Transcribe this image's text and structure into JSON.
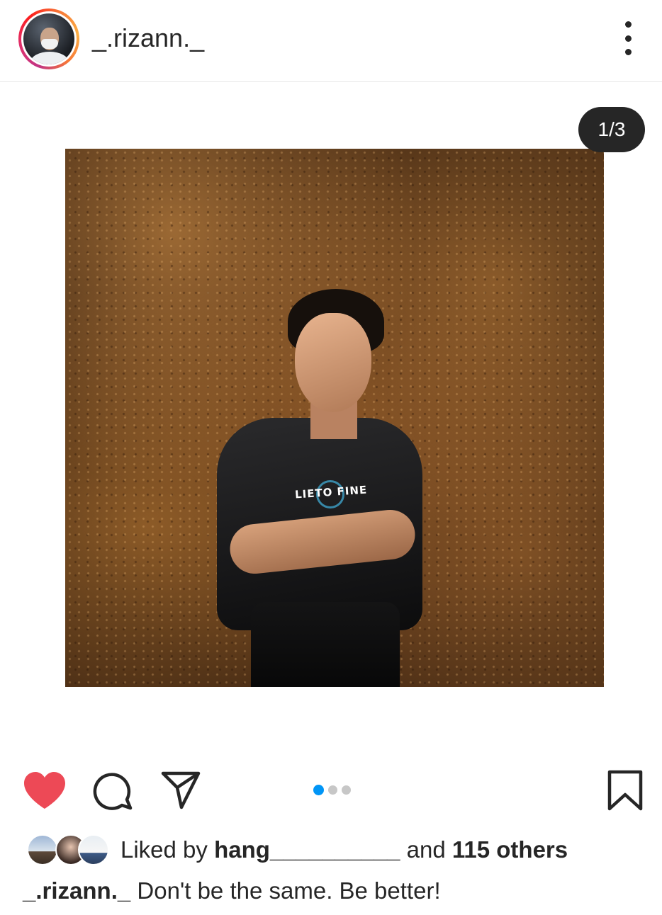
{
  "post": {
    "username": "_.rizann._",
    "media_counter": "1/3",
    "shirt_text": "LIETO FINE",
    "carousel": {
      "count": 3,
      "active_index": 0
    },
    "liked": true
  },
  "likes": {
    "prefix": "Liked by ",
    "liker": "hang__________",
    "middle": " and ",
    "others": "115 others"
  },
  "caption": {
    "username": "_.rizann._",
    "text": " Don't be the same. Be better!"
  },
  "colors": {
    "heart": "#ed4956",
    "dot_active": "#0095f6",
    "dot_inactive": "#c7c7c7",
    "text": "#262626"
  },
  "icons": {
    "more": "more-vertical-icon",
    "like": "heart-filled-icon",
    "comment": "comment-bubble-icon",
    "share": "send-paper-plane-icon",
    "save": "bookmark-icon"
  }
}
